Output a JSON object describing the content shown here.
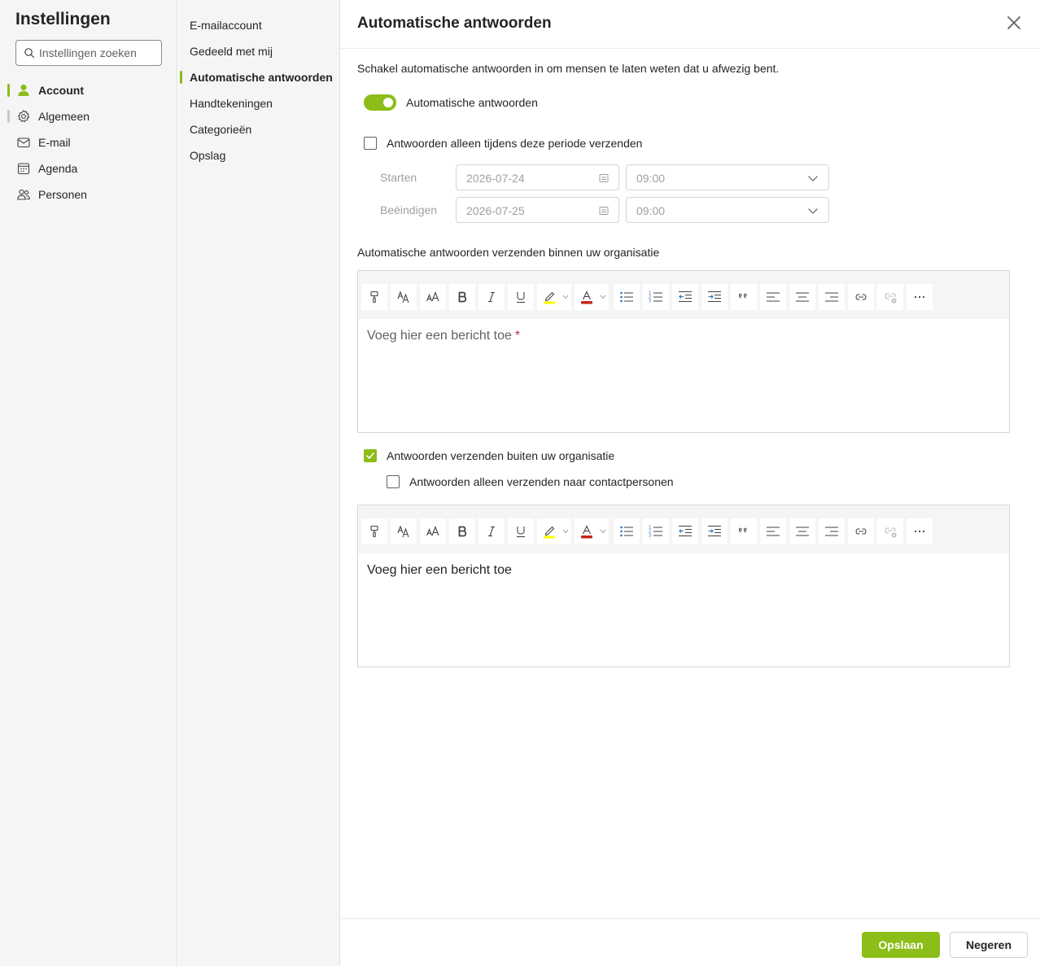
{
  "sidebar": {
    "title": "Instellingen",
    "search_placeholder": "Instellingen zoeken",
    "items": [
      {
        "label": "Account",
        "icon": "person-icon"
      },
      {
        "label": "Algemeen",
        "icon": "gear-icon"
      },
      {
        "label": "E-mail",
        "icon": "mail-icon"
      },
      {
        "label": "Agenda",
        "icon": "calendar-icon"
      },
      {
        "label": "Personen",
        "icon": "people-icon"
      }
    ]
  },
  "subnav": {
    "items": [
      {
        "label": "E-mailaccount"
      },
      {
        "label": "Gedeeld met mij"
      },
      {
        "label": "Automatische antwoorden"
      },
      {
        "label": "Handtekeningen"
      },
      {
        "label": "Categorieën"
      },
      {
        "label": "Opslag"
      }
    ]
  },
  "main": {
    "title": "Automatische antwoorden",
    "description": "Schakel automatische antwoorden in om mensen te laten weten dat u afwezig bent.",
    "toggle_label": "Automatische antwoorden",
    "toggle_on": true,
    "period_checkbox_label": "Antwoorden alleen tijdens deze periode verzenden",
    "start_label": "Starten",
    "start_date": "2026-07-24",
    "start_time": "09:00",
    "end_label": "Beëindigen",
    "end_date": "2026-07-25",
    "end_time": "09:00",
    "internal_label": "Automatische antwoorden verzenden binnen uw organisatie",
    "internal_placeholder": "Voeg hier een bericht toe",
    "required_mark": "*",
    "external_checkbox_label": "Antwoorden verzenden buiten uw organisatie",
    "contacts_checkbox_label": "Antwoorden alleen verzenden naar contactpersonen",
    "external_placeholder": "Voeg hier een bericht toe"
  },
  "footer": {
    "save_label": "Opslaan",
    "discard_label": "Negeren"
  },
  "colors": {
    "accent": "#8cbd18",
    "highlight": "#ffff00",
    "font_color": "#c4261d"
  }
}
